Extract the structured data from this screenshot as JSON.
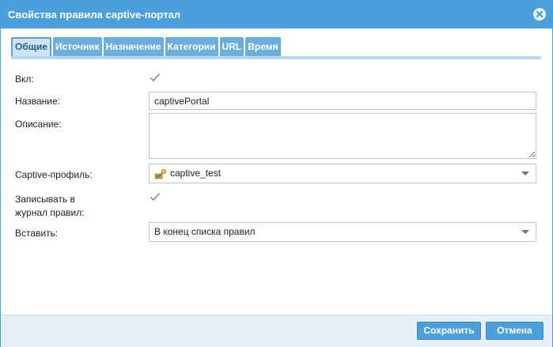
{
  "window": {
    "title": "Свойства правила captive-портал"
  },
  "tabs": [
    {
      "label": "Общие",
      "active": true
    },
    {
      "label": "Источник",
      "active": false
    },
    {
      "label": "Назначение",
      "active": false
    },
    {
      "label": "Категории",
      "active": false
    },
    {
      "label": "URL",
      "active": false
    },
    {
      "label": "Время",
      "active": false
    }
  ],
  "form": {
    "enabled": {
      "label": "Вкл:",
      "checked": true
    },
    "name": {
      "label": "Название:",
      "value": "captivePortal"
    },
    "description": {
      "label": "Описание:",
      "value": ""
    },
    "profile": {
      "label": "Captive-профиль:",
      "value": "captive_test",
      "icon": "key-icon"
    },
    "log": {
      "label_line1": "Записывать в",
      "label_line2": "журнал правил:",
      "checked": true
    },
    "insert": {
      "label": "Вставить:",
      "value": "В конец списка правил"
    }
  },
  "footer": {
    "save_label": "Сохранить",
    "cancel_label": "Отмена"
  },
  "colors": {
    "accent": "#4a9fdc",
    "tab_inactive": "#6aaee0",
    "tab_active_bg": "#cfe3f4",
    "footer_bg": "#e8eff5"
  }
}
